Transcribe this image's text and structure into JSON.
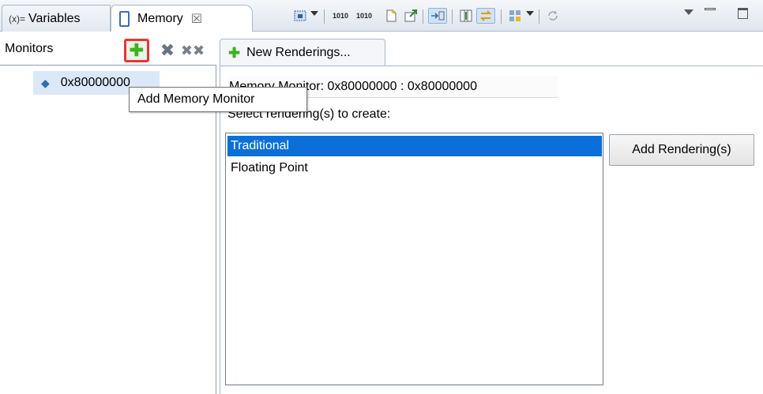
{
  "tabs": {
    "variables": {
      "icon": "(x)=",
      "label": "Variables"
    },
    "memory": {
      "label": "Memory",
      "close": "☒"
    }
  },
  "toolbar": {
    "icons": [
      "new-rendering-icon",
      "byte-order-big-icon",
      "byte-order-little-icon",
      "new-file-icon",
      "export-icon",
      "link-icon",
      "columns-icon",
      "sync-icon",
      "format-icon",
      "refresh-icon"
    ]
  },
  "view_menu": {
    "minimize": "▭",
    "maximize": "☐"
  },
  "monitors": {
    "header": "Monitors",
    "items": [
      {
        "label": "0x80000000"
      }
    ]
  },
  "tooltip": "Add Memory Monitor",
  "renderings": {
    "tab_label": "New Renderings...",
    "monitor_title": "Memory Monitor: 0x80000000 : 0x80000000",
    "select_label": "Select rendering(s) to create:",
    "options": [
      {
        "label": "Traditional",
        "selected": true
      },
      {
        "label": "Floating Point",
        "selected": false
      }
    ],
    "add_button": "Add Rendering(s)"
  },
  "colors": {
    "selection": "#0a6fd8",
    "add_icon": "#3bb31e",
    "highlight_border": "#e33333"
  }
}
